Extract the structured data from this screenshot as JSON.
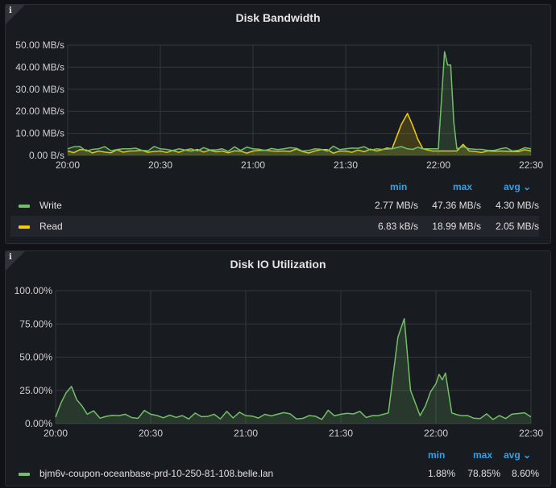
{
  "panels": [
    {
      "title": "Disk Bandwidth",
      "info_icon": "info-icon",
      "y_ticks": [
        "50.00 MB/s",
        "40.00 MB/s",
        "30.00 MB/s",
        "20.00 MB/s",
        "10.00 MB/s",
        "0.00 B/s"
      ],
      "x_ticks": [
        "20:00",
        "20:30",
        "21:00",
        "21:30",
        "22:00",
        "22:30"
      ],
      "legend_headers": {
        "min": "min",
        "max": "max",
        "avg": "avg ⌄"
      },
      "series": [
        {
          "name": "Write",
          "color": "#73bf69",
          "min": "2.77 MB/s",
          "max": "47.36 MB/s",
          "avg": "4.30 MB/s"
        },
        {
          "name": "Read",
          "color": "#f2cc0c",
          "min": "6.83 kB/s",
          "max": "18.99 MB/s",
          "avg": "2.05 MB/s"
        }
      ]
    },
    {
      "title": "Disk IO Utilization",
      "info_icon": "info-icon",
      "y_ticks": [
        "100.00%",
        "75.00%",
        "50.00%",
        "25.00%",
        "0.00%"
      ],
      "x_ticks": [
        "20:00",
        "20:30",
        "21:00",
        "21:30",
        "22:00",
        "22:30"
      ],
      "legend_headers": {
        "min": "min",
        "max": "max",
        "avg": "avg ⌄"
      },
      "series": [
        {
          "name": "bjm6v-coupon-oceanbase-prd-10-250-81-108.belle.lan",
          "color": "#73bf69",
          "min": "1.88%",
          "max": "78.85%",
          "avg": "8.60%"
        }
      ]
    }
  ],
  "chart_data": [
    {
      "type": "area",
      "title": "Disk Bandwidth",
      "unit": "MB/s",
      "ylim": [
        0,
        50
      ],
      "x_range": [
        "20:00",
        "22:30"
      ],
      "grid": true,
      "legend_placement": "bottom",
      "x": [
        "20:00",
        "20:10",
        "20:20",
        "20:30",
        "20:40",
        "20:50",
        "21:00",
        "21:10",
        "21:20",
        "21:30",
        "21:40",
        "21:45",
        "21:48",
        "21:50",
        "21:55",
        "21:58",
        "22:00",
        "22:01",
        "22:02",
        "22:03",
        "22:04",
        "22:05",
        "22:06",
        "22:08",
        "22:10",
        "22:20",
        "22:30"
      ],
      "series": [
        {
          "name": "Write",
          "values": [
            3,
            3,
            3,
            3,
            3,
            3,
            3,
            3,
            3,
            3,
            3,
            3,
            4,
            3,
            3,
            3,
            3,
            25,
            47,
            41,
            41,
            15,
            3,
            4,
            3,
            3,
            3
          ]
        },
        {
          "name": "Read",
          "values": [
            2,
            2,
            2,
            2,
            2,
            2,
            2,
            2,
            2,
            2,
            2,
            3,
            14,
            19,
            3,
            2,
            2,
            2,
            2,
            2,
            2,
            2,
            2,
            5,
            2,
            2,
            2
          ]
        }
      ]
    },
    {
      "type": "area",
      "title": "Disk IO Utilization",
      "unit": "%",
      "ylim": [
        0,
        100
      ],
      "x_range": [
        "20:00",
        "22:30"
      ],
      "grid": true,
      "legend_placement": "bottom",
      "x": [
        "20:00",
        "20:05",
        "20:10",
        "20:20",
        "20:30",
        "20:40",
        "20:50",
        "21:00",
        "21:10",
        "21:20",
        "21:30",
        "21:40",
        "21:45",
        "21:48",
        "21:50",
        "21:52",
        "21:55",
        "22:00",
        "22:01",
        "22:02",
        "22:03",
        "22:05",
        "22:10",
        "22:20",
        "22:30"
      ],
      "series": [
        {
          "name": "bjm6v-coupon-oceanbase-prd-10-250-81-108.belle.lan",
          "values": [
            5,
            28,
            7,
            6,
            7,
            6,
            7,
            6,
            7,
            6,
            7,
            6,
            8,
            65,
            79,
            25,
            6,
            30,
            37,
            33,
            38,
            8,
            6,
            6,
            5
          ]
        }
      ]
    }
  ]
}
